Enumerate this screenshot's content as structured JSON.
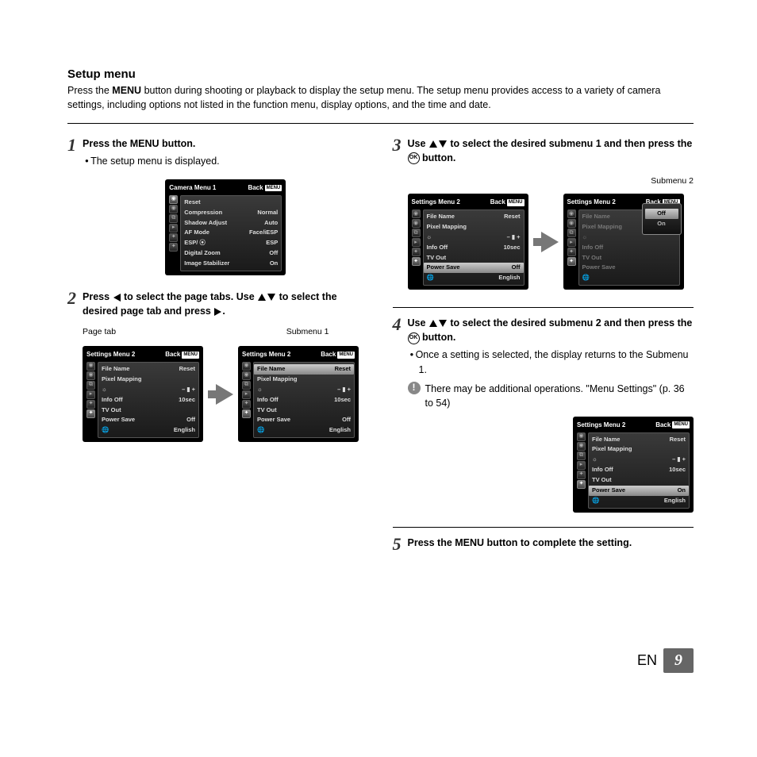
{
  "title": "Setup menu",
  "intro_pre": "Press the ",
  "intro_menu": "MENU",
  "intro_post": " button during shooting or playback to display the setup menu. The setup menu provides access to a variety of camera settings, including options not listed in the function menu, display options, and the time and date.",
  "step1": {
    "num": "1",
    "title_pre": "Press the ",
    "title_menu": "MENU",
    "title_post": " button.",
    "bullet": "The setup menu is displayed."
  },
  "step2": {
    "num": "2",
    "title_a": "Press ",
    "title_b": " to select the page tabs. Use ",
    "title_c": " to select the desired page tab and press ",
    "title_d": ".",
    "label_left": "Page tab",
    "label_right": "Submenu 1"
  },
  "step3": {
    "num": "3",
    "title_a": "Use ",
    "title_b": " to select the desired submenu 1 and then press the ",
    "title_c": " button.",
    "label": "Submenu 2"
  },
  "step4": {
    "num": "4",
    "title_a": "Use ",
    "title_b": " to select the desired submenu 2 and then press the ",
    "title_c": " button.",
    "bullet": "Once a setting is selected, the display returns to the Submenu 1.",
    "note": "There may be additional operations. \"Menu Settings\" (p. 36 to 54)"
  },
  "step5": {
    "num": "5",
    "title_pre": "Press the ",
    "title_menu": "MENU",
    "title_post": " button to complete the setting."
  },
  "scr_camera": {
    "title": "Camera Menu 1",
    "back": "Back",
    "menu": "MENU",
    "rows": [
      [
        "Reset",
        ""
      ],
      [
        "Compression",
        "Normal"
      ],
      [
        "Shadow Adjust",
        "Auto"
      ],
      [
        "AF Mode",
        "Face/iESP"
      ],
      [
        "ESP/ ⦿",
        "ESP"
      ],
      [
        "Digital Zoom",
        "Off"
      ],
      [
        "Image Stabilizer",
        "On"
      ]
    ]
  },
  "scr_settings": {
    "title": "Settings Menu 2",
    "back": "Back",
    "menu": "MENU",
    "rows": [
      [
        "File Name",
        "Reset"
      ],
      [
        "Pixel Mapping",
        ""
      ],
      [
        "☼",
        "– ▮ +"
      ],
      [
        "Info Off",
        "10sec"
      ],
      [
        "TV Out",
        ""
      ],
      [
        "Power Save",
        "Off"
      ],
      [
        "🌐",
        "English"
      ]
    ]
  },
  "scr_settings_hl_file": {
    "rows": [
      [
        "File Name",
        "Reset"
      ],
      [
        "Pixel Mapping",
        ""
      ],
      [
        "☼",
        "– ▮ +"
      ],
      [
        "Info Off",
        "10sec"
      ],
      [
        "TV Out",
        ""
      ],
      [
        "Power Save",
        "Off"
      ],
      [
        "🌐",
        "English"
      ]
    ],
    "hl": 0
  },
  "scr_settings_hl_ps": {
    "rows": [
      [
        "File Name",
        "Reset"
      ],
      [
        "Pixel Mapping",
        ""
      ],
      [
        "☼",
        "– ▮ +"
      ],
      [
        "Info Off",
        "10sec"
      ],
      [
        "TV Out",
        ""
      ],
      [
        "Power Save",
        "Off"
      ],
      [
        "🌐",
        "English"
      ]
    ],
    "hl": 5
  },
  "scr_settings_dim": {
    "rows": [
      [
        "File Name",
        ""
      ],
      [
        "Pixel Mapping",
        ""
      ],
      [
        "☼",
        ""
      ],
      [
        "Info Off",
        ""
      ],
      [
        "TV Out",
        ""
      ],
      [
        "Power Save",
        ""
      ],
      [
        "🌐",
        ""
      ]
    ]
  },
  "popup": {
    "off": "Off",
    "on": "On"
  },
  "scr_settings_on": {
    "rows": [
      [
        "File Name",
        "Reset"
      ],
      [
        "Pixel Mapping",
        ""
      ],
      [
        "☼",
        "– ▮ +"
      ],
      [
        "Info Off",
        "10sec"
      ],
      [
        "TV Out",
        ""
      ],
      [
        "Power Save",
        "On"
      ],
      [
        "🌐",
        "English"
      ]
    ],
    "hl": 5
  },
  "tabs": [
    "◉",
    "◉",
    "⧉",
    "▸",
    "✦",
    "✦"
  ],
  "footer": {
    "lang": "EN",
    "page": "9"
  }
}
